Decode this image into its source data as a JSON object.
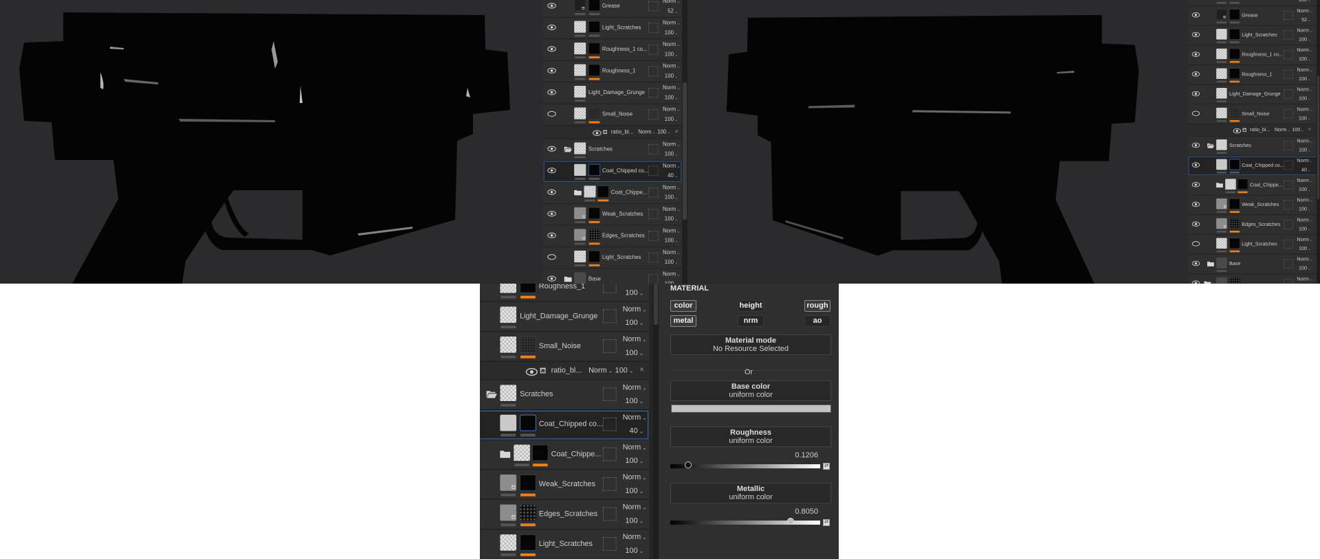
{
  "colors": {
    "accent_orange": "#f0801a",
    "selection_blue": "#3b78c4",
    "viewport_bg": "#2b2b2d"
  },
  "layer_stack": [
    {
      "type": "partial-top",
      "opacity": "100"
    },
    {
      "type": "layer",
      "name": "Grease",
      "blend": "Norm",
      "opacity": "52",
      "visible": true,
      "thumb": "darkfill",
      "mask": "m-black",
      "bar2": "gray"
    },
    {
      "type": "layer",
      "name": "Light_Scratches",
      "blend": "Norm",
      "opacity": "100",
      "visible": true,
      "thumb": "checker",
      "mask": "m-black",
      "bar2": "gray"
    },
    {
      "type": "layer",
      "name": "Roughness_1 co...",
      "blend": "Norm",
      "opacity": "100",
      "visible": true,
      "thumb": "checker",
      "mask": "m-black",
      "bar2": "orange"
    },
    {
      "type": "layer",
      "name": "Roughness_1",
      "blend": "Norm",
      "opacity": "100",
      "visible": true,
      "thumb": "checker",
      "mask": "m-black",
      "bar2": "orange"
    },
    {
      "type": "layer",
      "name": "Light_Damage_Grunge",
      "blend": "Norm",
      "opacity": "100",
      "visible": true,
      "thumb": "checker",
      "mask": "none"
    },
    {
      "type": "layer",
      "name": "Small_Noise",
      "blend": "Norm",
      "opacity": "100",
      "visible": false,
      "thumb": "checker",
      "mask": "m-soft",
      "bar2": "orange"
    },
    {
      "type": "effect",
      "name": "ratio_bl...",
      "blend": "Norm",
      "opacity": "100",
      "close": "×"
    },
    {
      "type": "folder",
      "name": "Scratches",
      "blend": "Norm",
      "opacity": "100",
      "visible": true,
      "open": true,
      "thumb": "checker"
    },
    {
      "type": "layer",
      "name": "Coat_Chipped co...",
      "blend": "Norm",
      "opacity": "40",
      "visible": true,
      "selected": true,
      "thumb": "light",
      "mask": "m-sel",
      "bar2": "gray"
    },
    {
      "type": "subfolder",
      "name": "Coat_Chippe...",
      "blend": "Norm",
      "opacity": "100",
      "visible": true,
      "thumb": "checker",
      "mask": "m-black",
      "bar2": "orange"
    },
    {
      "type": "layer",
      "name": "Weak_Scratches",
      "blend": "Norm",
      "opacity": "100",
      "visible": true,
      "thumb": "grayfill",
      "mask": "m-black",
      "bar2": "orange"
    },
    {
      "type": "layer",
      "name": "Edges_Scratches",
      "blend": "Norm",
      "opacity": "100",
      "visible": true,
      "thumb": "grayfill",
      "mask": "m-noise",
      "bar2": "orange"
    },
    {
      "type": "layer",
      "name": "Light_Scratches",
      "blend": "Norm",
      "opacity": "100",
      "visible": false,
      "thumb": "checker",
      "mask": "m-black",
      "bar2": "orange"
    },
    {
      "type": "folder",
      "name": "Base",
      "blend": "Norm",
      "opacity": "100",
      "visible": true,
      "open": false,
      "thumb": "basefill"
    },
    {
      "type": "partial-bottom",
      "blend": "Norm"
    }
  ],
  "panels": {
    "left": {
      "first": 1,
      "last": 14
    },
    "right": {
      "first": 0,
      "last": 15
    },
    "bottom": {
      "first": 4,
      "last": 13
    }
  },
  "material": {
    "title": "MATERIAL",
    "channels": [
      {
        "label": "color",
        "active": true
      },
      {
        "label": "height",
        "active": false
      },
      {
        "label": "rough",
        "active": true
      },
      {
        "label": "metal",
        "active": true
      },
      {
        "label": "nrm",
        "active": false
      },
      {
        "label": "ao",
        "active": false
      }
    ],
    "material_mode": {
      "title": "Material mode",
      "value": "No Resource Selected"
    },
    "or_label": "Or",
    "base_color": {
      "title": "Base color",
      "mode": "uniform color",
      "swatch": "#c2c2c2"
    },
    "roughness": {
      "title": "Roughness",
      "mode": "uniform color",
      "value": "0.1206",
      "fraction": 0.1206
    },
    "metallic": {
      "title": "Metallic",
      "mode": "uniform color",
      "value": "0.8050",
      "fraction": 0.805
    }
  }
}
